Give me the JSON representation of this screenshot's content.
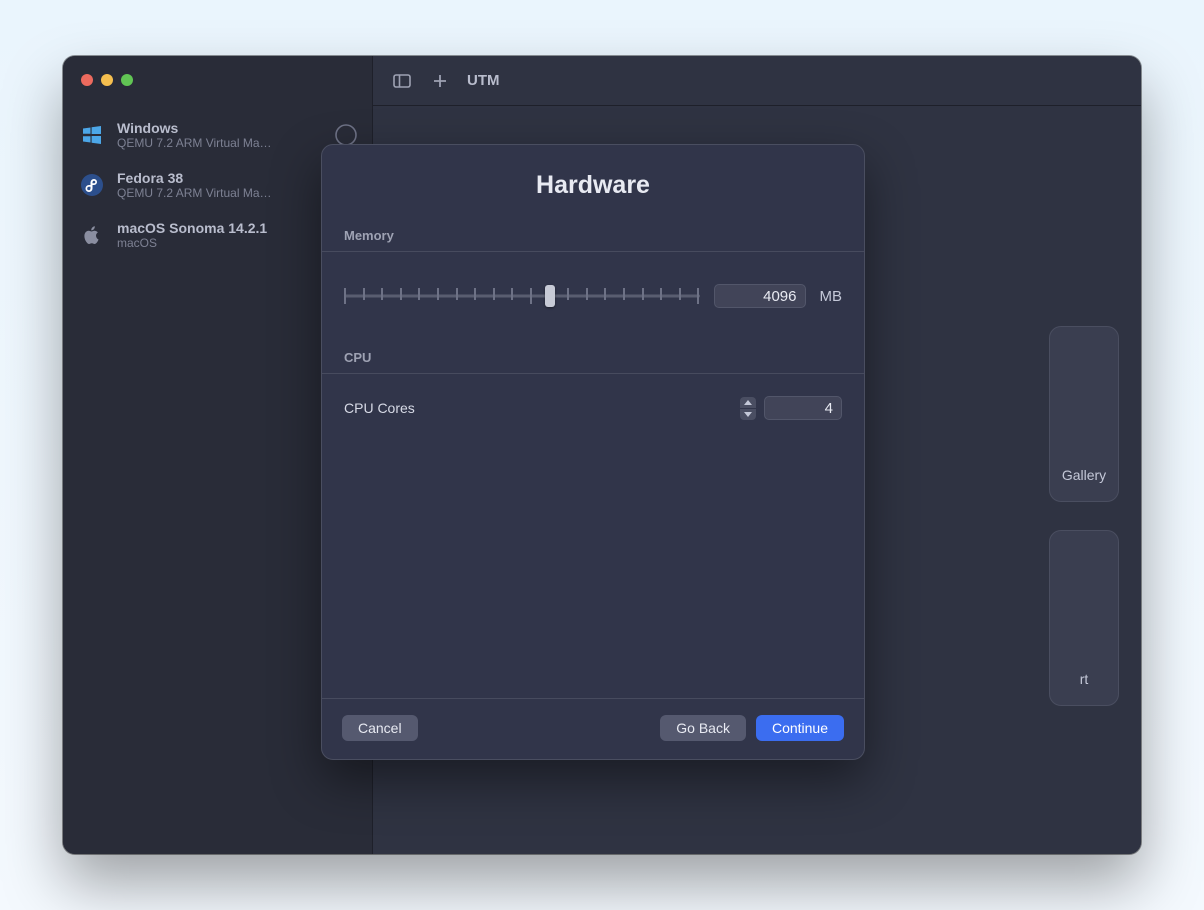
{
  "window": {
    "title": "UTM"
  },
  "sidebar": {
    "items": [
      {
        "title": "Windows",
        "subtitle": "QEMU 7.2 ARM Virtual Ma…",
        "icon": "windows"
      },
      {
        "title": "Fedora 38",
        "subtitle": "QEMU 7.2 ARM Virtual Ma…",
        "icon": "fedora"
      },
      {
        "title": "macOS Sonoma 14.2.1",
        "subtitle": "macOS",
        "icon": "apple"
      }
    ]
  },
  "background": {
    "cards": [
      {
        "label": "Gallery"
      },
      {
        "label": "rt"
      }
    ]
  },
  "sheet": {
    "title": "Hardware",
    "memory": {
      "section_label": "Memory",
      "value": "4096",
      "unit": "MB",
      "slider_percent": 58
    },
    "cpu": {
      "section_label": "CPU",
      "row_label": "CPU Cores",
      "value": "4"
    },
    "buttons": {
      "cancel": "Cancel",
      "go_back": "Go Back",
      "continue": "Continue"
    }
  }
}
